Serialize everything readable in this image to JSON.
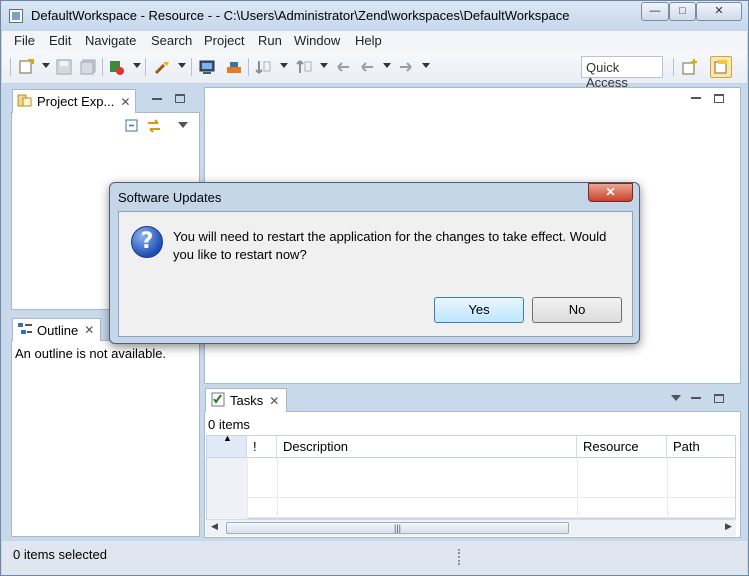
{
  "window": {
    "title": "DefaultWorkspace - Resource -  - C:\\Users\\Administrator\\Zend\\workspaces\\DefaultWorkspace",
    "controls": {
      "minimize": "—",
      "maximize": "□",
      "close": "✕"
    }
  },
  "menu": [
    "File",
    "Edit",
    "Navigate",
    "Search",
    "Project",
    "Run",
    "Window",
    "Help"
  ],
  "toolbar": {
    "quick_access": "Quick Access",
    "icons": [
      "new-icon",
      "save-icon",
      "save-all-icon",
      "run-icon",
      "external-tools-icon",
      "terminal-icon",
      "build-icon",
      "next-annotation-icon",
      "prev-annotation-icon",
      "last-edit-icon",
      "back-icon",
      "forward-icon",
      "open-perspective-icon",
      "resource-perspective-icon"
    ]
  },
  "project_explorer": {
    "tab_label": "Project Exp...",
    "close": "✕"
  },
  "outline": {
    "tab_label": "Outline",
    "close": "✕",
    "message": "An outline is not available."
  },
  "tasks": {
    "tab_label": "Tasks",
    "close": "✕",
    "count": "0 items",
    "columns": [
      "",
      "!",
      "Description",
      "Resource",
      "Path"
    ]
  },
  "status": {
    "text": "0 items selected"
  },
  "dialog": {
    "title": "Software Updates",
    "close": "✕",
    "message": "You will need to restart the application for the changes to take effect. Would you like to restart now?",
    "yes_label": "Yes",
    "no_label": "No"
  }
}
